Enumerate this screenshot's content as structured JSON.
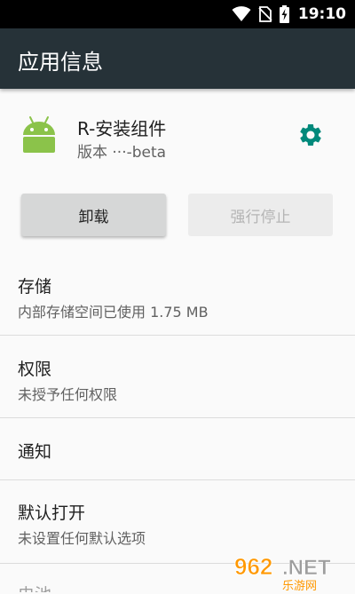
{
  "status_bar": {
    "time": "19:10",
    "icons": [
      "wifi-icon",
      "no-sim-icon",
      "battery-charging-icon"
    ]
  },
  "app_bar": {
    "title": "应用信息"
  },
  "app": {
    "name": "R-安装组件",
    "version": "版本 ···-beta",
    "icon": "android-icon",
    "settings_icon": "gear-icon",
    "accent_color": "#00897b"
  },
  "actions": {
    "uninstall_label": "卸载",
    "force_stop_label": "强行停止"
  },
  "sections": {
    "storage": {
      "title": "存储",
      "subtitle": "内部存储空间已使用 1.75 MB"
    },
    "permissions": {
      "title": "权限",
      "subtitle": "未授予任何权限"
    },
    "notifications": {
      "title": "通知"
    },
    "default_open": {
      "title": "默认打开",
      "subtitle": "未设置任何默认选项"
    },
    "battery": {
      "title": "电池"
    }
  },
  "watermark": {
    "logo_text": "962.NET",
    "caption": "乐游网"
  }
}
